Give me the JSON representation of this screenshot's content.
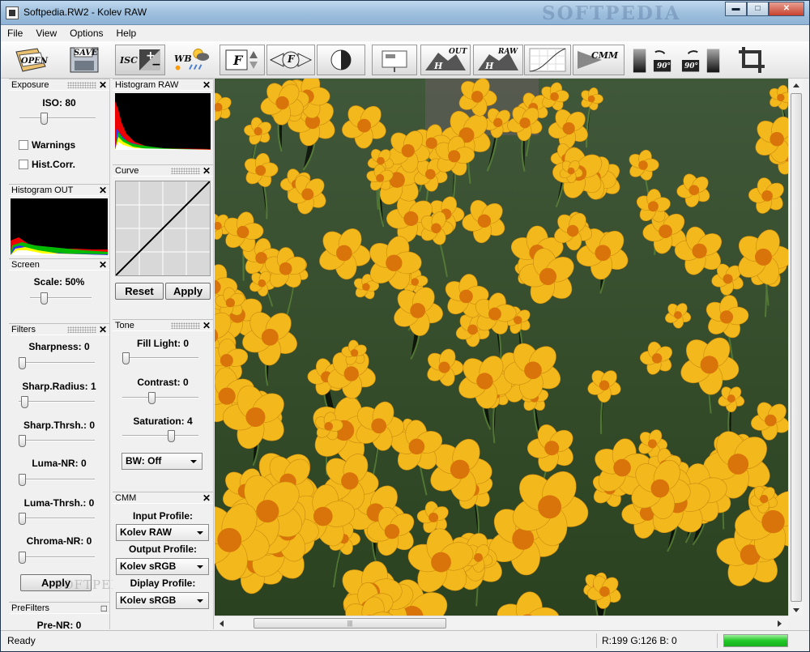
{
  "window": {
    "title": "Softpedia.RW2 - Kolev RAW",
    "watermark": "SOFTPEDIA",
    "controls": {
      "minimize": "▬",
      "maximize": "□",
      "close": "✕"
    }
  },
  "menu": [
    "File",
    "View",
    "Options",
    "Help"
  ],
  "toolbar": {
    "open_label": "OPEN",
    "save_label": "SAVE",
    "isc_label": "ISC",
    "wb_label": "WB",
    "f_label": "F",
    "f2_label": "F",
    "out_label": "OUT",
    "out_h": "H",
    "raw_label": "RAW",
    "raw_h": "H",
    "cmm_label": "CMM",
    "rot_left": "90°",
    "rot_right": "90°",
    "icons": [
      "open-icon",
      "save-icon",
      "exposure-icon",
      "white-balance-icon",
      "filter-icon",
      "filter-arrows-icon",
      "contrast-icon",
      "screen-icon",
      "histogram-out-icon",
      "histogram-raw-icon",
      "curve-icon",
      "cmm-icon",
      "rotate-left-icon",
      "rotate-right-icon",
      "crop-icon"
    ]
  },
  "exposure": {
    "title": "Exposure",
    "iso_label": "ISO: 80",
    "iso_level": 0.3,
    "warnings": "Warnings",
    "hist_corr": "Hist.Corr."
  },
  "histogram_out": {
    "title": "Histogram OUT"
  },
  "screen": {
    "title": "Screen",
    "scale_label": "Scale: 50%",
    "scale_level": 0.2
  },
  "filters": {
    "title": "Filters",
    "items": [
      {
        "label": "Sharpness: 0",
        "level": 0
      },
      {
        "label": "Sharp.Radius: 1",
        "level": 0.04
      },
      {
        "label": "Sharp.Thrsh.: 0",
        "level": 0
      },
      {
        "label": "Luma-NR: 0",
        "level": 0
      },
      {
        "label": "Luma-Thrsh.: 0",
        "level": 0
      },
      {
        "label": "Chroma-NR: 0",
        "level": 0
      }
    ],
    "apply": "Apply",
    "watermark": "SOFTPEDIA"
  },
  "prefilters": {
    "title": "PreFilters",
    "pre_nr": "Pre-NR: 0"
  },
  "histogram_raw": {
    "title": "Histogram RAW"
  },
  "curve": {
    "title": "Curve",
    "reset": "Reset",
    "apply": "Apply"
  },
  "tone": {
    "title": "Tone",
    "items": [
      {
        "label": "Fill Light: 0",
        "level": 0
      },
      {
        "label": "Contrast: 0",
        "level": 0.38
      },
      {
        "label": "Saturation: 4",
        "level": 0.66
      }
    ],
    "bw": "BW: Off"
  },
  "cmm": {
    "title": "CMM",
    "input_label": "Input Profile:",
    "input_value": "Kolev RAW",
    "output_label": "Output Profile:",
    "output_value": "Kolev sRGB",
    "display_label": "Diplay Profile:",
    "display_value": "Kolev sRGB"
  },
  "status": {
    "text": "Ready",
    "rgb": "R:199 G:126 B:  0",
    "progress": 1.0
  },
  "colors": {
    "accent": "#22c828",
    "flower": "#f2b619",
    "foliage": "#3b5a2c"
  }
}
